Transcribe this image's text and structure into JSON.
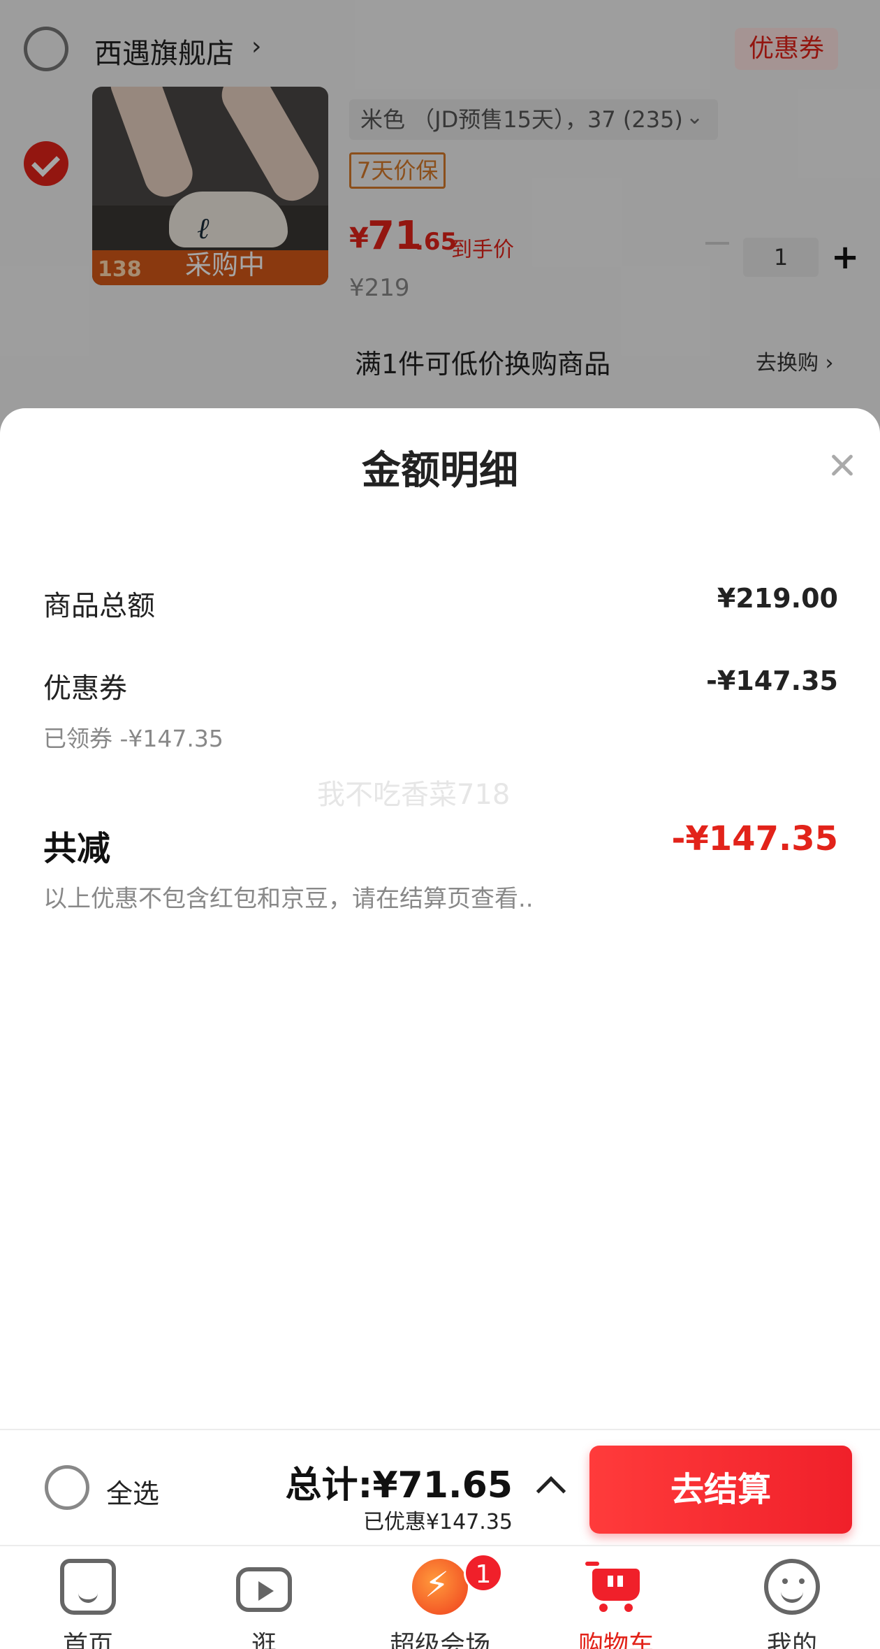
{
  "cart": {
    "store_name": "西遇旗舰店",
    "store_chevron": "›",
    "coupon_label": "优惠券",
    "product": {
      "image_overlay_text": "采购中",
      "image_price_tag": "138",
      "sku": "米色 （JD预售15天），37 (235)",
      "sku_chevron": "⌄",
      "tag": "7天价保",
      "price_currency": "¥",
      "price_int": "71",
      "price_dec": ".65",
      "price_label": "到手价",
      "original_price": "¥219",
      "quantity": "1",
      "plus": "+"
    },
    "swap_text": "满1件可低价换购商品",
    "swap_link": "去换购 ›"
  },
  "sheet": {
    "title": "金额明细",
    "rows": [
      {
        "label": "商品总额",
        "value": "¥219.00"
      },
      {
        "label": "优惠券",
        "value": "-¥147.35",
        "sub": "已领券 -¥147.35"
      }
    ],
    "watermark": "我不吃香菜718",
    "total_label": "共减",
    "total_value": "-¥147.35",
    "note": "以上优惠不包含红包和京豆，请在结算页查看.."
  },
  "checkout": {
    "select_all": "全选",
    "total": "总计:¥71.65",
    "saved": "已优惠¥147.35",
    "button": "去结算"
  },
  "tabs": [
    {
      "label": "首页",
      "icon": "home-icon"
    },
    {
      "label": "逛",
      "icon": "video-icon"
    },
    {
      "label": "超级会场",
      "icon": "super-venue-icon",
      "badge": "1"
    },
    {
      "label": "购物车",
      "icon": "cart-icon",
      "active": true
    },
    {
      "label": "我的",
      "icon": "profile-icon"
    }
  ],
  "colors": {
    "accent": "#e2231a",
    "coupon_bg": "#fde4e2",
    "tag": "#d67a2a"
  }
}
